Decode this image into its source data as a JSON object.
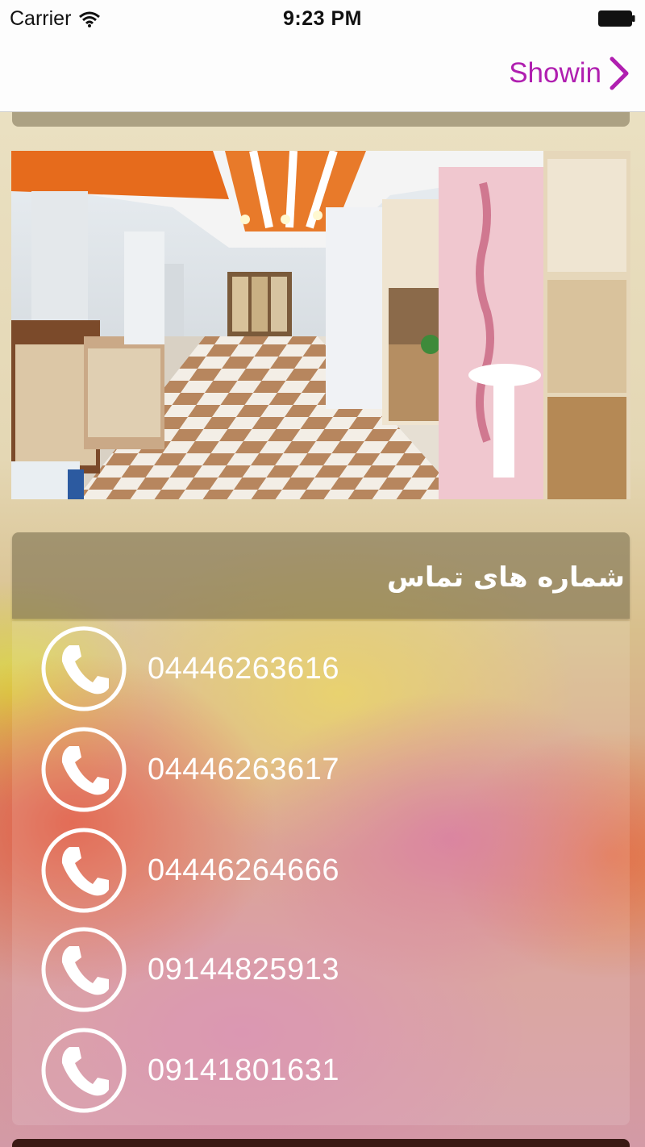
{
  "status_bar": {
    "carrier": "Carrier",
    "time": "9:23 PM"
  },
  "nav": {
    "forward_label": "Showin"
  },
  "contact": {
    "title": "شماره های تماس",
    "phones": [
      "04446263616",
      "04446263617",
      "04446264666",
      "09144825913",
      "09141801631"
    ]
  },
  "colors": {
    "nav_accent": "#b01fb0",
    "phone_text": "#ffffff"
  },
  "icons": {
    "wifi": "wifi-icon",
    "battery": "battery-icon",
    "forward": "chevron-right-icon",
    "phone": "phone-icon"
  }
}
